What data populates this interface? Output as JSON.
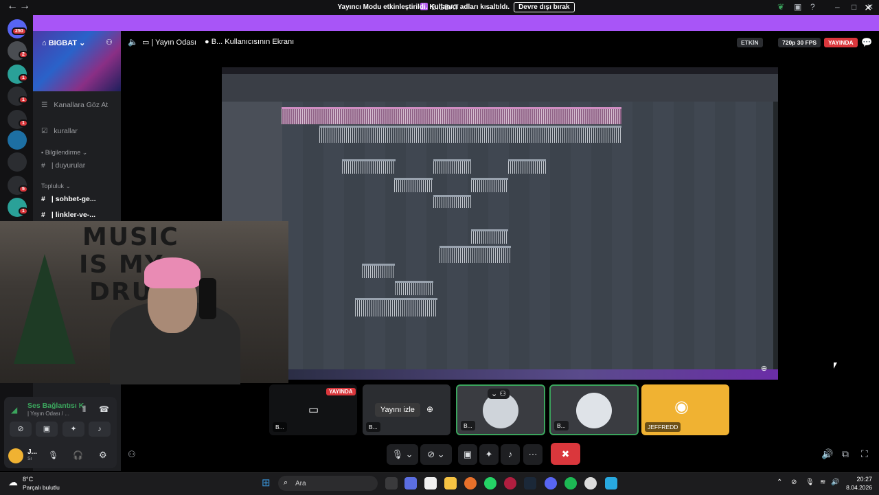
{
  "window": {
    "title": "BIGBAT",
    "back": "←",
    "forward": "→"
  },
  "banner": {
    "message": "Yayıncı Modu etkinleştirildi. Kullanıcı adları kısaltıldı.",
    "button": "Devre dışı bırak"
  },
  "rail": {
    "badges": [
      "250",
      "2",
      "1",
      "1",
      "1",
      "1",
      "5",
      "1"
    ]
  },
  "server": {
    "name": "BIGBAT",
    "channels": {
      "browse": "Kanallara Göz At",
      "rules": "kurallar",
      "info_category": "Bilgilendirme",
      "announcements": "| duyurular",
      "community_category": "Topluluk",
      "chat": "| sohbet-ge...",
      "links": "| linkler-ve-..."
    }
  },
  "header": {
    "voice_channel": "| Yayın Odası",
    "screen_title": "B... Kullanıcısının Ekranı",
    "status": "ETKİN",
    "quality": "720p 30 FPS",
    "live": "YAYINDA"
  },
  "voice": {
    "status": "Ses Bağlantısı K",
    "sub": "| Yayın Odası / ...",
    "user_initial": "J...",
    "user_status": "Sı"
  },
  "tiles": {
    "live_badge": "YAYINDA",
    "watch_button": "Yayını izle",
    "t1": "B...",
    "t2": "B...",
    "t3": "B...",
    "t4": "B...",
    "t5": "JEFFREDD"
  },
  "taskbar": {
    "temp": "8°C",
    "weather": "Parçalı bulutlu",
    "search": "Ara",
    "time": "20:27",
    "date": "8.04.2026"
  },
  "webcam": {
    "poster_line1": "MUSIC",
    "poster_line2": "IS MY",
    "poster_line3": "DRU"
  },
  "colors": {
    "accent": "#a855f7",
    "live": "#da373c",
    "connected": "#3ba55d",
    "discord_tile": "#f0b232"
  }
}
